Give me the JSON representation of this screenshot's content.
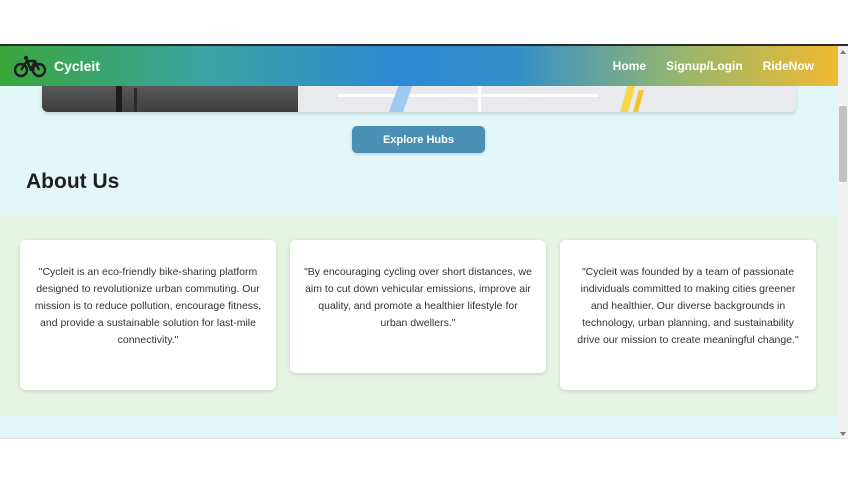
{
  "nav": {
    "brand": "Cycleit",
    "links": [
      "Home",
      "Signup/Login",
      "RideNow"
    ]
  },
  "explore_button": "Explore Hubs",
  "about": {
    "title": "About Us",
    "cards": [
      "\"Cycleit is an eco-friendly bike-sharing platform designed to revolutionize urban commuting. Our mission is to reduce pollution, encourage fitness, and provide a sustainable solution for last-mile connectivity.\"",
      "\"By encouraging cycling over short distances, we aim to cut down vehicular emissions, improve air quality, and promote a healthier lifestyle for urban dwellers.\"",
      "\"Cycleit was founded by a team of passionate individuals committed to making cities greener and healthier. Our diverse backgrounds in technology, urban planning, and sustainability drive our mission to create meaningful change.\""
    ]
  },
  "icons": [
    "bicycle-logo-icon",
    "scroll-up-icon",
    "scroll-down-icon"
  ],
  "colors": {
    "nav_start": "#3aa63c",
    "nav_mid": "#2e88d4",
    "nav_end": "#f0b931",
    "button": "#4a8fb5",
    "page_bg": "#e3f7f8",
    "about_bg": "#e6f5e2"
  }
}
